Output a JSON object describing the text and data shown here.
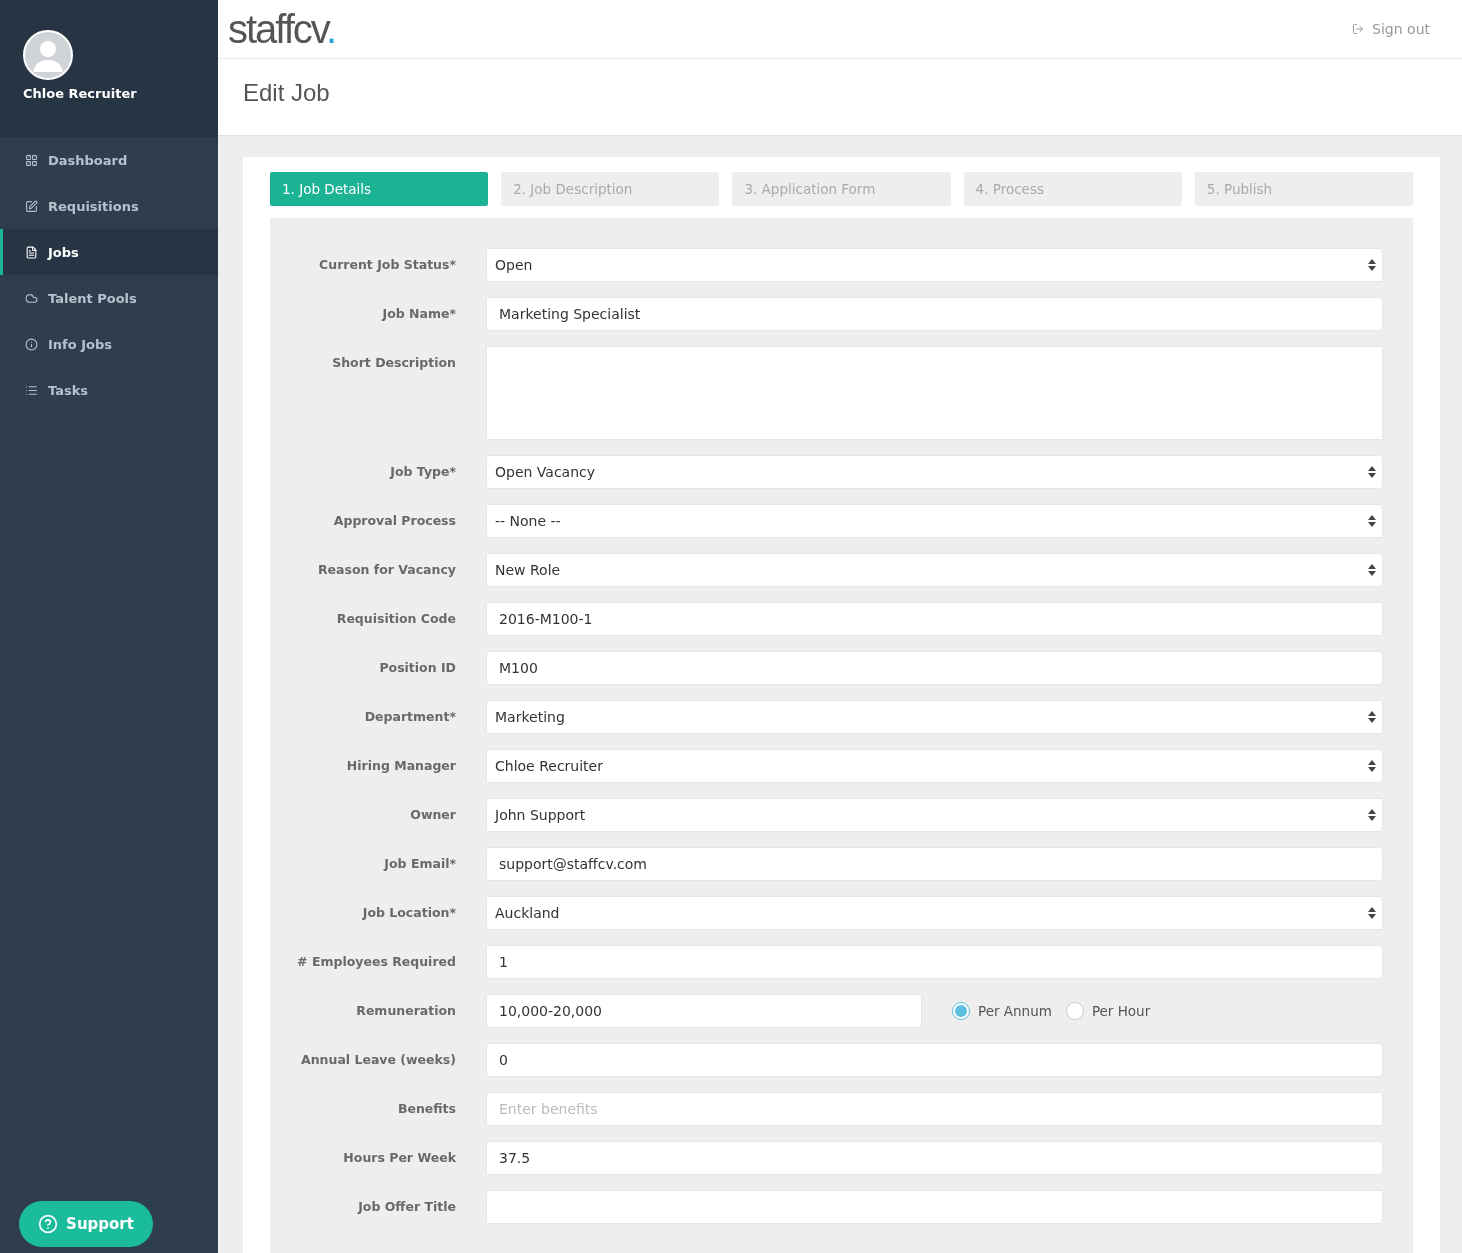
{
  "user": {
    "name": "Chloe Recruiter"
  },
  "nav": [
    {
      "label": "Dashboard",
      "selected": false
    },
    {
      "label": "Requisitions",
      "selected": false
    },
    {
      "label": "Jobs",
      "selected": true
    },
    {
      "label": "Talent Pools",
      "selected": false
    },
    {
      "label": "Info Jobs",
      "selected": false
    },
    {
      "label": "Tasks",
      "selected": false
    }
  ],
  "support": {
    "label": "Support"
  },
  "header": {
    "logo": "staffcv",
    "logo_dot": ".",
    "sign_out": "Sign out"
  },
  "page_title": "Edit Job",
  "steps": [
    {
      "label": "1. Job Details",
      "selected": true
    },
    {
      "label": "2. Job Description",
      "selected": false
    },
    {
      "label": "3. Application Form",
      "selected": false
    },
    {
      "label": "4. Process",
      "selected": false
    },
    {
      "label": "5. Publish",
      "selected": false
    }
  ],
  "form": [
    {
      "kind": "select",
      "label": "Current Job Status*",
      "value": "Open"
    },
    {
      "kind": "input",
      "label": "Job Name*",
      "value": "Marketing Specialist"
    },
    {
      "kind": "textarea",
      "label": "Short Description"
    },
    {
      "kind": "select",
      "label": "Job Type*",
      "value": "Open Vacancy"
    },
    {
      "kind": "select",
      "label": "Approval Process",
      "value": "-- None --"
    },
    {
      "kind": "select",
      "label": "Reason for Vacancy",
      "value": "New Role"
    },
    {
      "kind": "input",
      "label": "Requisition Code",
      "value": "2016-M100-1"
    },
    {
      "kind": "input",
      "label": "Position ID",
      "value": "M100"
    },
    {
      "kind": "select",
      "label": "Department*",
      "value": "Marketing"
    },
    {
      "kind": "select",
      "label": "Hiring Manager",
      "value": "Chloe Recruiter"
    },
    {
      "kind": "select",
      "label": "Owner",
      "value": "John Support"
    },
    {
      "kind": "input",
      "label": "Job Email*",
      "value": "support@staffcv.com"
    },
    {
      "kind": "select",
      "label": "Job Location*",
      "value": "Auckland"
    },
    {
      "kind": "input",
      "label": "# Employees Required",
      "value": "1"
    },
    {
      "kind": "remuneration",
      "label": "Remuneration",
      "value": "10,000-20,000",
      "options": [
        {
          "label": "Per Annum",
          "selected": true
        },
        {
          "label": "Per Hour",
          "selected": false
        }
      ]
    },
    {
      "kind": "input",
      "label": "Annual Leave (weeks)",
      "value": "0"
    },
    {
      "kind": "input",
      "label": "Benefits",
      "placeholder": "Enter benefits"
    },
    {
      "kind": "input",
      "label": "Hours Per Week",
      "value": "37.5"
    },
    {
      "kind": "input",
      "label": "Job Offer Title"
    }
  ]
}
